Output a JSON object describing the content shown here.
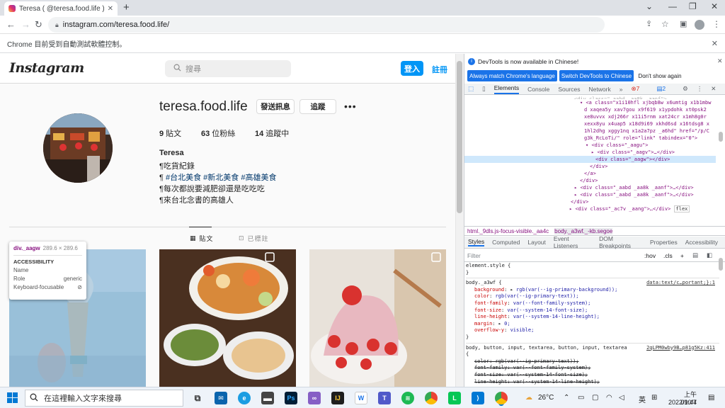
{
  "browser": {
    "tab_title": "Teresa ( @teresa.food.life ) • In",
    "new_tab": "+",
    "url": "instagram.com/teresa.food.life/",
    "automation_notice": "Chrome 目前受到自動測試軟體控制。"
  },
  "instagram": {
    "logo": "Instagram",
    "search_placeholder": "搜尋",
    "login_label": "登入",
    "signup_label": "註冊",
    "username": "teresa.food.life",
    "message_label": "發送訊息",
    "follow_label": "追蹤",
    "more": "•••",
    "stats": [
      {
        "count": "9",
        "label": "貼文"
      },
      {
        "count": "63",
        "label": "位粉絲"
      },
      {
        "count": "14",
        "label": "追蹤中"
      }
    ],
    "display_name": "Teresa",
    "bio": {
      "line1": "¶吃貨紀錄",
      "line2_prefix": "¶ ",
      "tag1": "#台北美食",
      "tag2": "#新北美食",
      "tag3": "#高雄美食",
      "line3": "¶每次都說要減肥卻還是吃吃吃",
      "line4": "¶來台北念書的高雄人"
    },
    "tabs": {
      "posts": "貼文",
      "tagged": "已標註"
    }
  },
  "inspect_tooltip": {
    "selector": "div._aagw",
    "size": "289.6 × 289.6",
    "section": "ACCESSIBILITY",
    "name_label": "Name",
    "name_value": "",
    "role_label": "Role",
    "role_value": "generic",
    "focus_label": "Keyboard-focusable"
  },
  "devtools": {
    "banner_text": "DevTools is now available in Chinese!",
    "btn_match": "Always match Chrome's language",
    "btn_switch": "Switch DevTools to Chinese",
    "btn_dont": "Don't show again",
    "tabs": [
      "Elements",
      "Console",
      "Sources",
      "Network"
    ],
    "errors": "7",
    "messages": "2",
    "breadcrumb1": "html._9dls.js-focus-visible._aa4c",
    "breadcrumb2": "body._a3wf._-kb.segoe",
    "style_tabs": [
      "Styles",
      "Computed",
      "Layout",
      "Event Listeners",
      "DOM Breakpoints",
      "Properties",
      "Accessibility"
    ],
    "filter_placeholder": "Filter",
    "hov": ":hov",
    "cls": ".cls",
    "dom_lines": {
      "a0": "<div class=\"_aabd _aa8k _aanf\">",
      "a1": "<a class=\"x1i10hfl xjbqb8w x6umtig x1b1mbw",
      "a2": "d xaqea5y xav7gou x9f619 x1ypdohk xt0psk2",
      "a3": "xe8uvvx xdj266r x11i5rnm xat24cr x1mh8g0r",
      "a4": "xexx8yu x4uap5 x18d9i69 xkhd6sd x16tdsg8 x",
      "a5": "1hl2dhg xggy1nq x1a2a7pz _a6hd\" href=\"/p/C",
      "a6": "g3k_RcLoTi/\" role=\"link\" tabindex=\"0\">",
      "b1": "<div class=\"_aagu\">",
      "b2": "<div class=\"_aagv\">…</div>",
      "b3": "<div class=\"_aagw\"></div>",
      "b4": "</div>",
      "b5": "</a>",
      "b6": "</div>",
      "c1": "<div class=\"_aabd _aa8k _aanf\">…</div>",
      "c2": "<div class=\"_aabd _aa8k _aanf\">…</div>",
      "c3": "</div>",
      "c4": "<div class=\"_ac7v _aang\">…</div>",
      "flex": "flex"
    },
    "css_lines": {
      "e1": "element.style {",
      "e2": "}",
      "r1": "body._a3wf {",
      "src1": "data:text/c…portant;}:1",
      "p1": "background",
      "v1": "rgb(var(--ig-primary-background));",
      "p2": "color",
      "v2": "rgb(var(--ig-primary-text));",
      "p3": "font-family",
      "v3": "var(--font-family-system);",
      "p4": "font-size",
      "v4": "var(--system-14-font-size);",
      "p5": "line-height",
      "v5": "var(--system-14-line-height);",
      "p6": "margin",
      "v6": "0;",
      "p7": "overflow-y",
      "v7": "visible;",
      "r1end": "}",
      "r2": "body, button, input, textarea, button, input, textarea",
      "src2": "2qLPM0wby9B…p81g5Kz:411",
      "r2open": "{",
      "s1": "color: rgb(var(--ig-primary-text));",
      "s2": "font-family: var(--font-family-system);",
      "s3": "font-size: var(--system-14-font-size);",
      "s4": "line-height: var(--system-14-line-height);"
    }
  },
  "taskbar": {
    "search_placeholder": "在這裡輸入文字來搜尋",
    "weather": "26°C",
    "ime": "英",
    "time": "上午 09:44",
    "date": "2022/10/7"
  }
}
